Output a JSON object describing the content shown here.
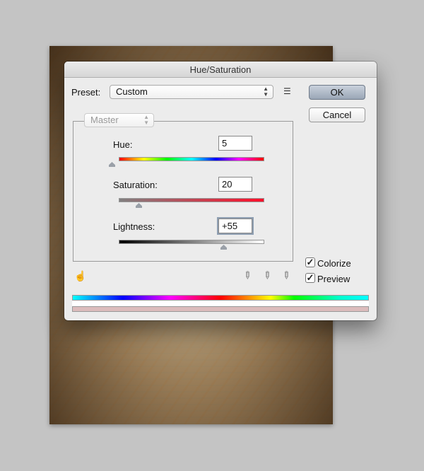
{
  "dialog": {
    "title": "Hue/Saturation"
  },
  "preset": {
    "label": "Preset:",
    "value": "Custom",
    "menu_icon": "preset-options-icon"
  },
  "buttons": {
    "ok": "OK",
    "cancel": "Cancel"
  },
  "channel": {
    "value": "Master"
  },
  "hue": {
    "label": "Hue:",
    "value": "5",
    "range": [
      -180,
      180
    ]
  },
  "saturation": {
    "label": "Saturation:",
    "value": "20",
    "range": [
      0,
      100
    ]
  },
  "lightness": {
    "label": "Lightness:",
    "value": "+55",
    "range": [
      -100,
      100
    ]
  },
  "options": {
    "colorize": {
      "label": "Colorize",
      "checked": true
    },
    "preview": {
      "label": "Preview",
      "checked": true
    }
  },
  "icons": [
    "targeted-adjustment-hand-icon",
    "eyedropper-icon",
    "eyedropper-add-icon",
    "eyedropper-subtract-icon"
  ],
  "colors": {
    "result_bar": "#dcbcbc",
    "ok_button": "#aab4c2"
  }
}
